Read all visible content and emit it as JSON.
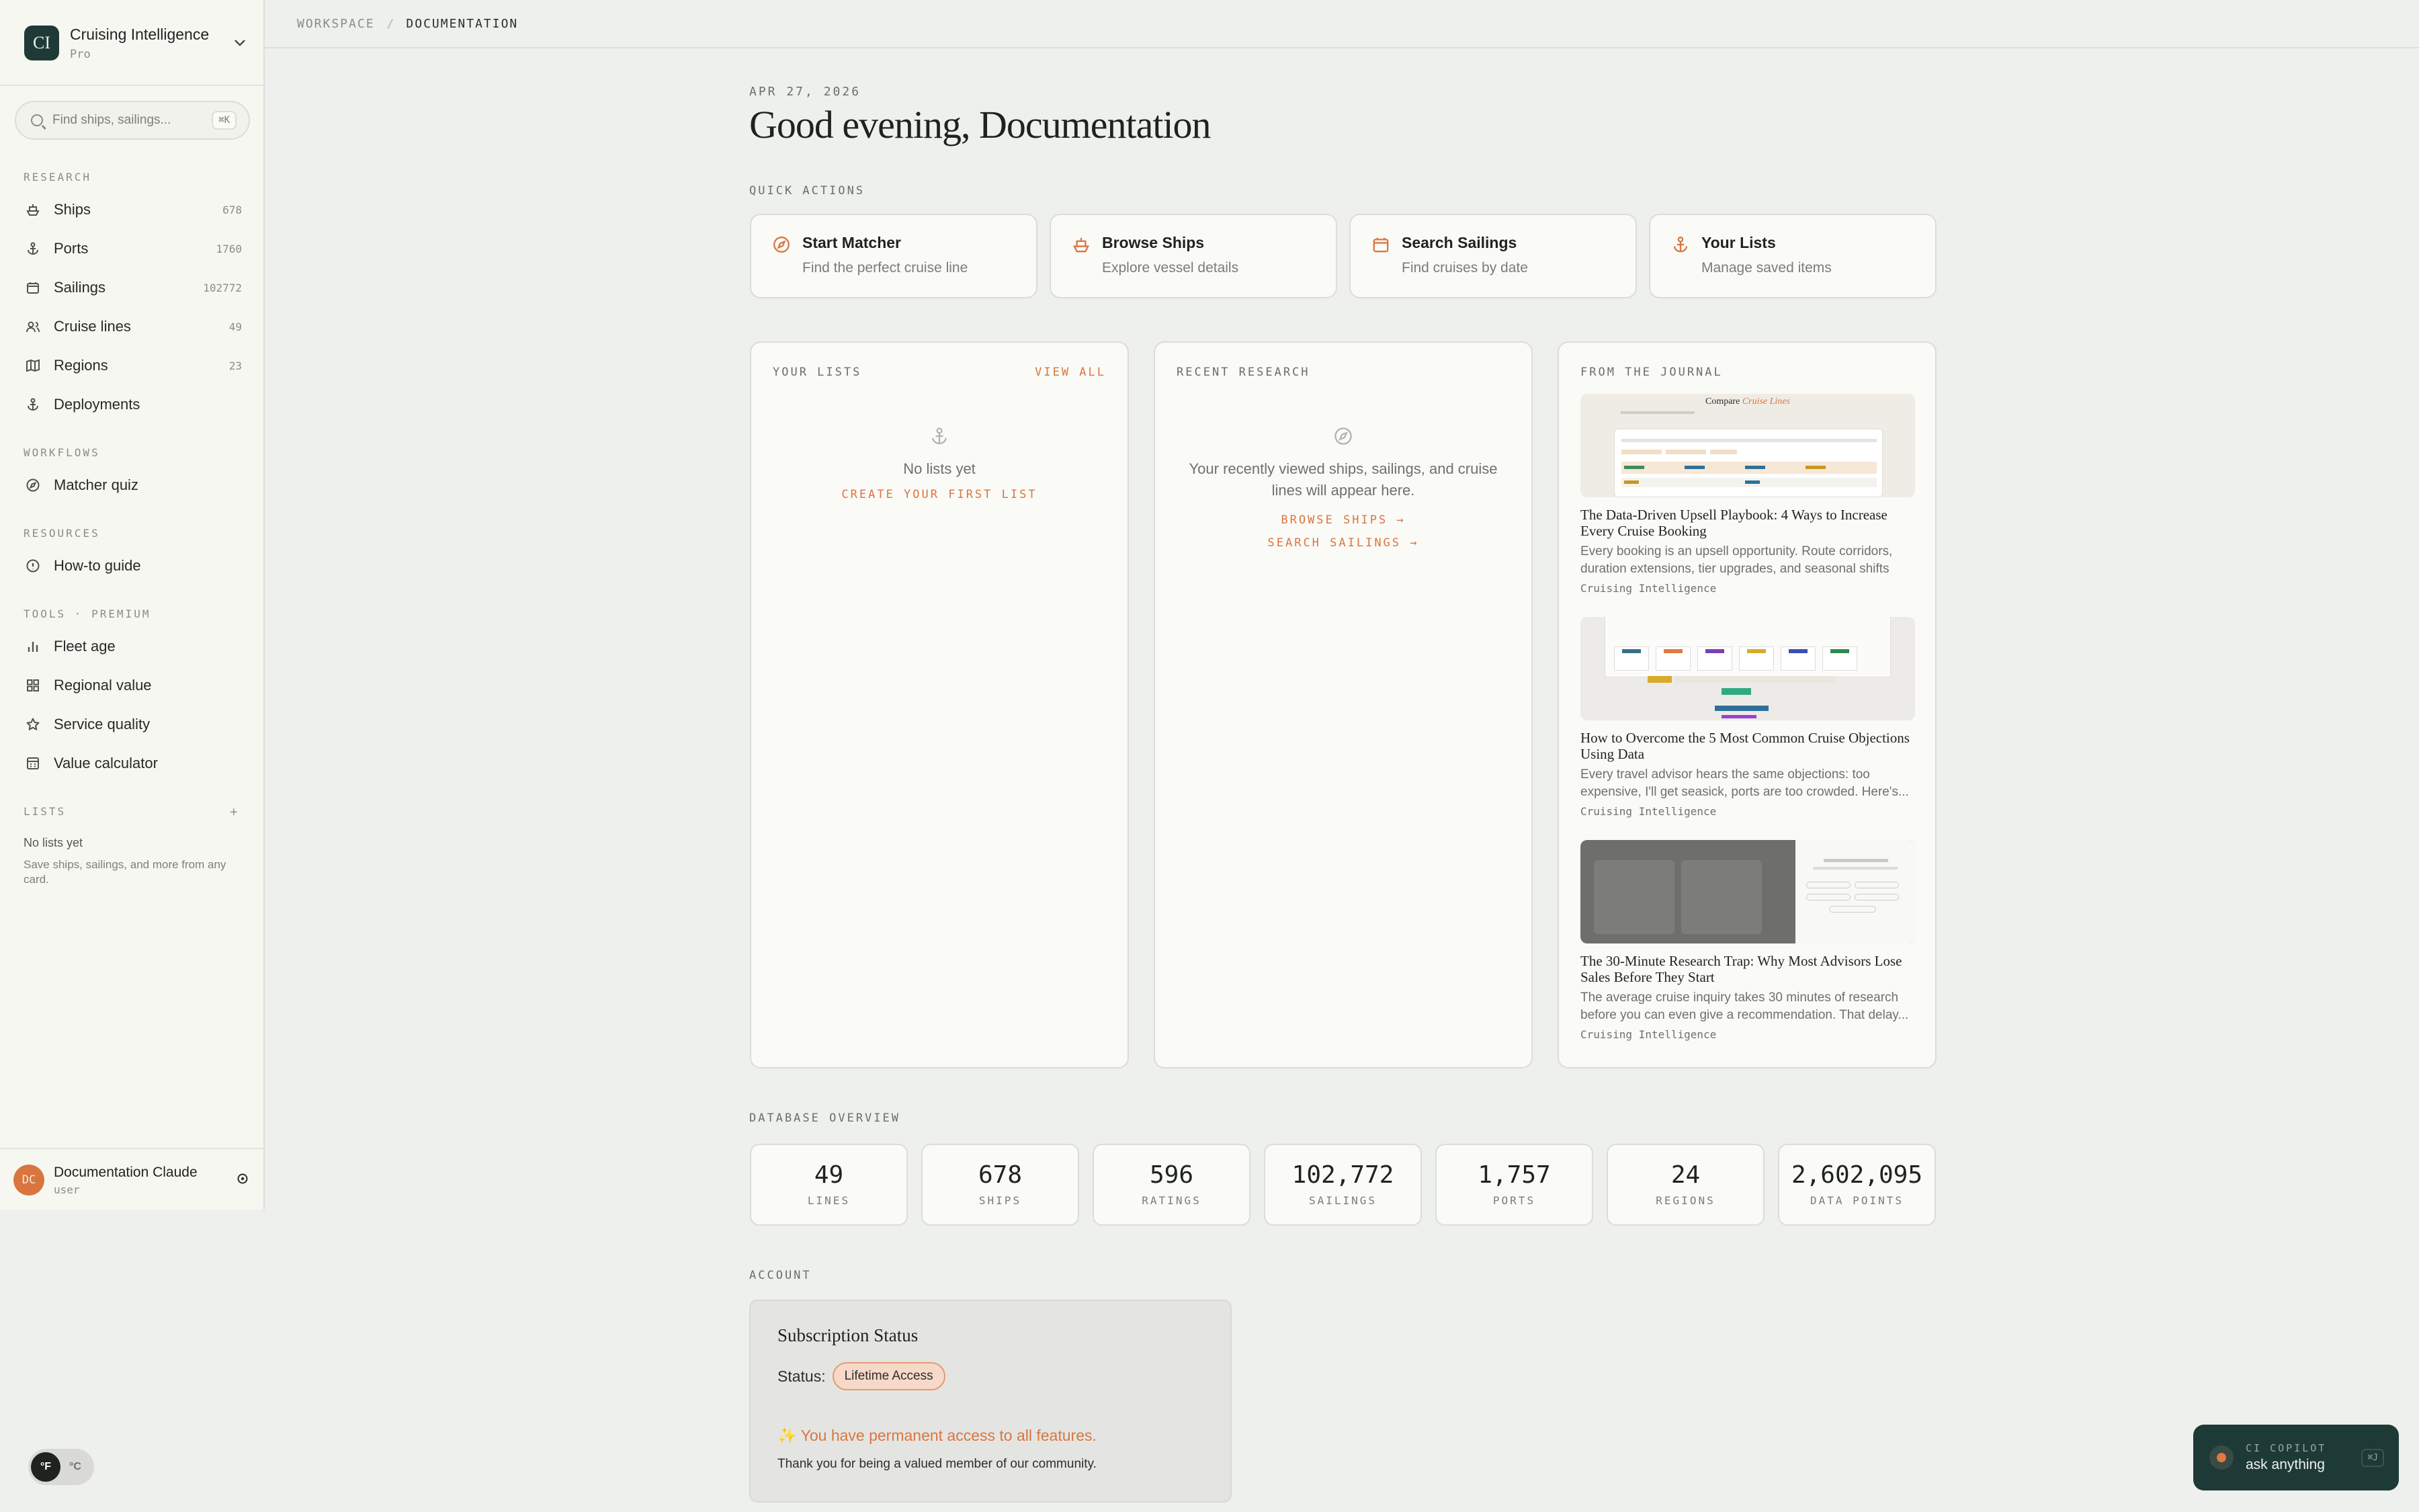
{
  "sidebar": {
    "brand": {
      "logo": "CI",
      "name": "Cruising Intelligence",
      "plan": "Pro"
    },
    "search": {
      "placeholder": "Find ships, sailings...",
      "shortcut": "⌘K"
    },
    "sections": {
      "research": "RESEARCH",
      "workflows": "WORKFLOWS",
      "resources": "RESOURCES",
      "tools": "TOOLS · PREMIUM",
      "lists": "LISTS"
    },
    "research": [
      {
        "label": "Ships",
        "count": "678",
        "icon": "ship-icon"
      },
      {
        "label": "Ports",
        "count": "1760",
        "icon": "anchor-icon"
      },
      {
        "label": "Sailings",
        "count": "102772",
        "icon": "calendar-icon"
      },
      {
        "label": "Cruise lines",
        "count": "49",
        "icon": "users-icon"
      },
      {
        "label": "Regions",
        "count": "23",
        "icon": "map-icon"
      },
      {
        "label": "Deployments",
        "count": "",
        "icon": "anchor-icon"
      }
    ],
    "workflows": [
      {
        "label": "Matcher quiz",
        "icon": "compass-icon"
      }
    ],
    "resources": [
      {
        "label": "How-to guide",
        "icon": "info-icon"
      }
    ],
    "tools": [
      {
        "label": "Fleet age",
        "icon": "bar-chart-icon"
      },
      {
        "label": "Regional value",
        "icon": "grid-icon"
      },
      {
        "label": "Service quality",
        "icon": "star-icon"
      },
      {
        "label": "Value calculator",
        "icon": "calculator-icon"
      }
    ],
    "lists_empty": "No lists yet",
    "lists_hint": "Save ships, sailings, and more from any card.",
    "user": {
      "initials": "DC",
      "name": "Documentation Claude",
      "role": "user"
    }
  },
  "breadcrumb": {
    "root": "WORKSPACE",
    "current": "DOCUMENTATION"
  },
  "main": {
    "date": "APR 27, 2026",
    "greeting": "Good evening, Documentation",
    "quick_actions_label": "QUICK ACTIONS",
    "quick_actions": [
      {
        "title": "Start Matcher",
        "sub": "Find the perfect cruise line",
        "icon": "compass-icon"
      },
      {
        "title": "Browse Ships",
        "sub": "Explore vessel details",
        "icon": "ship-icon"
      },
      {
        "title": "Search Sailings",
        "sub": "Find cruises by date",
        "icon": "calendar-icon"
      },
      {
        "title": "Your Lists",
        "sub": "Manage saved items",
        "icon": "anchor-icon"
      }
    ],
    "lists_panel": {
      "label": "YOUR LISTS",
      "view_all": "VIEW ALL",
      "empty": "No lists yet",
      "cta": "CREATE YOUR FIRST LIST"
    },
    "recent_panel": {
      "label": "RECENT RESEARCH",
      "empty": "Your recently viewed ships, sailings, and cruise lines will appear here.",
      "browse": "BROWSE SHIPS →",
      "search": "SEARCH SAILINGS →"
    },
    "journal_panel": {
      "label": "FROM THE JOURNAL",
      "articles": [
        {
          "title": "The Data-Driven Upsell Playbook: 4 Ways to Increase Every Cruise Booking",
          "excerpt": "Every booking is an upsell opportunity. Route corridors, duration extensions, tier upgrades, and seasonal shifts —...",
          "source": "Cruising Intelligence",
          "img_heading": "Compare",
          "img_heading_em": "Cruise Lines"
        },
        {
          "title": "How to Overcome the 5 Most Common Cruise Objections Using Data",
          "excerpt": "Every travel advisor hears the same objections: too expensive, I'll get seasick, ports are too crowded. Here's...",
          "source": "Cruising Intelligence"
        },
        {
          "title": "The 30-Minute Research Trap: Why Most Advisors Lose Sales Before They Start",
          "excerpt": "The average cruise inquiry takes 30 minutes of research before you can even give a recommendation. That delay...",
          "source": "Cruising Intelligence"
        }
      ]
    },
    "db_label": "DATABASE OVERVIEW",
    "stats": [
      {
        "value": "49",
        "label": "LINES"
      },
      {
        "value": "678",
        "label": "SHIPS"
      },
      {
        "value": "596",
        "label": "RATINGS"
      },
      {
        "value": "102,772",
        "label": "SAILINGS"
      },
      {
        "value": "1,757",
        "label": "PORTS"
      },
      {
        "value": "24",
        "label": "REGIONS"
      },
      {
        "value": "2,602,095",
        "label": "DATA POINTS"
      }
    ],
    "account_label": "ACCOUNT",
    "account": {
      "title": "Subscription Status",
      "status_label": "Status:",
      "status_value": "Lifetime Access",
      "permanent": "✨ You have permanent access to all features.",
      "thanks": "Thank you for being a valued member of our community."
    }
  },
  "units": {
    "f": "°F",
    "c": "°C",
    "selected": "°F"
  },
  "copilot": {
    "title": "CI COPILOT",
    "sub": "ask anything",
    "shortcut": "⌘J"
  },
  "colors": {
    "accent": "#d9763f",
    "brand": "#1f3a36",
    "background": "#eef0ee"
  }
}
